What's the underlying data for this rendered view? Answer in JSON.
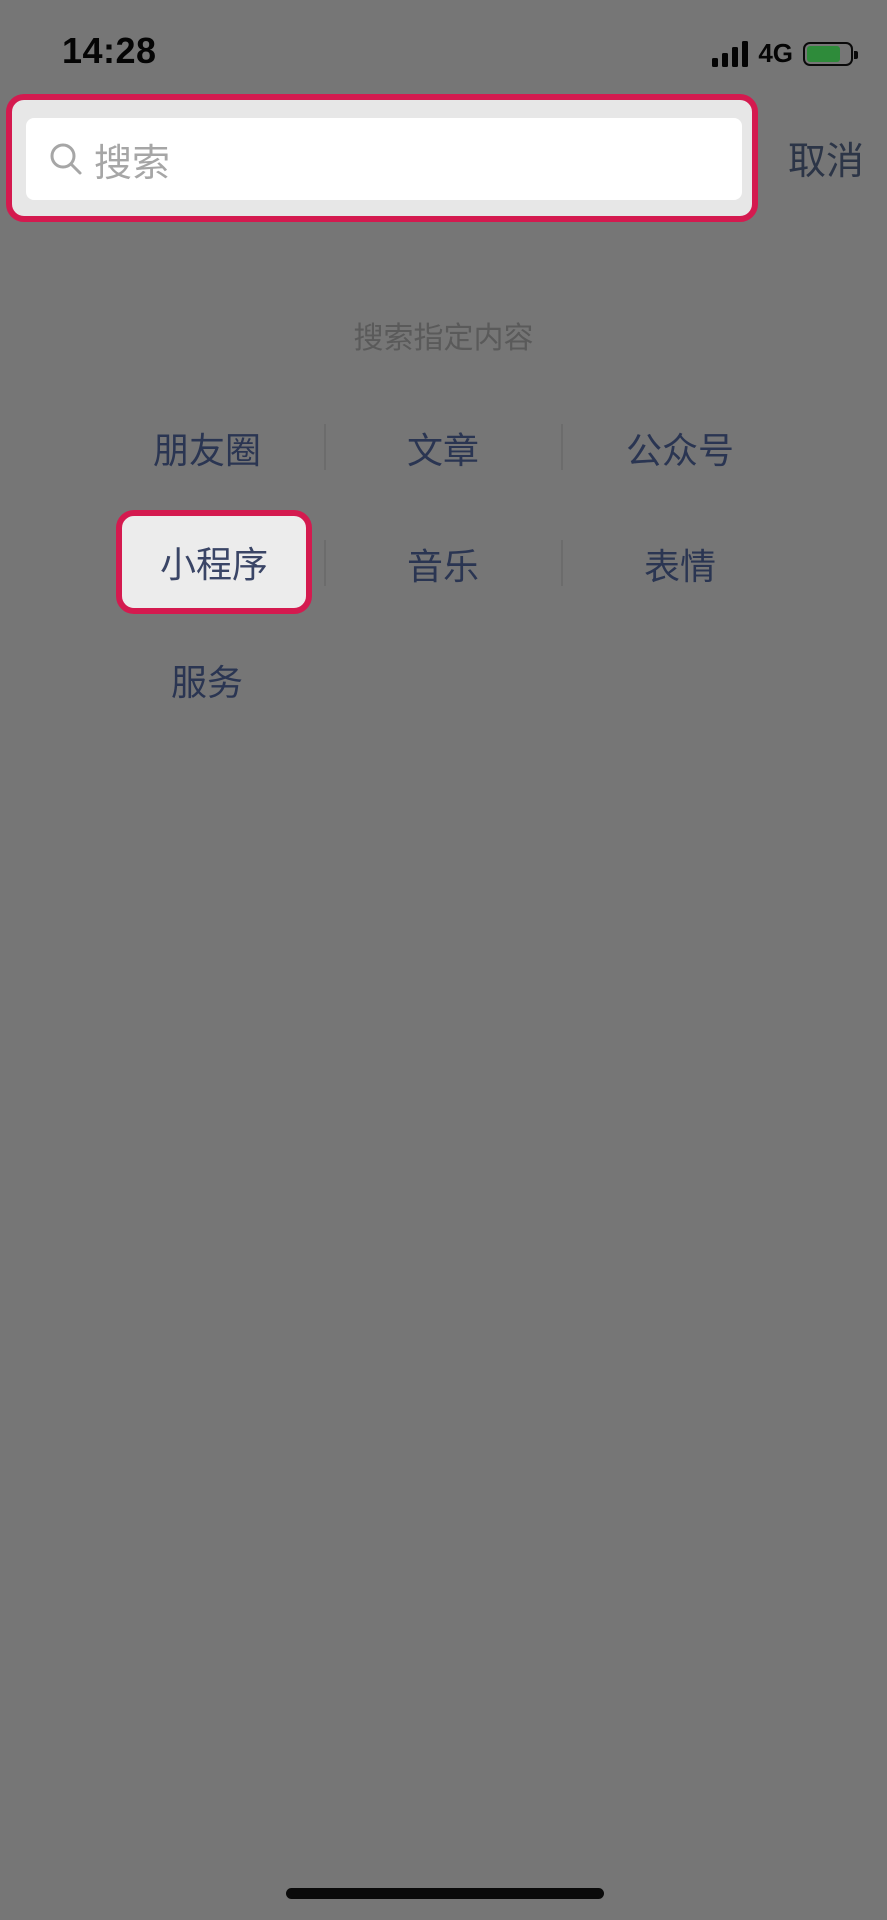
{
  "status_bar": {
    "time": "14:28",
    "network": "4G",
    "battery_level": 0.78,
    "battery_color": "#2e8b3a"
  },
  "search": {
    "placeholder": "搜索",
    "cancel_label": "取消"
  },
  "section": {
    "title": "搜索指定内容"
  },
  "categories": [
    {
      "label": "朋友圈"
    },
    {
      "label": "文章"
    },
    {
      "label": "公众号"
    },
    {
      "label": "小程序"
    },
    {
      "label": "音乐"
    },
    {
      "label": "表情"
    },
    {
      "label": "服务"
    }
  ],
  "colors": {
    "highlight": "#d41a4f",
    "overlay": "#767676"
  }
}
